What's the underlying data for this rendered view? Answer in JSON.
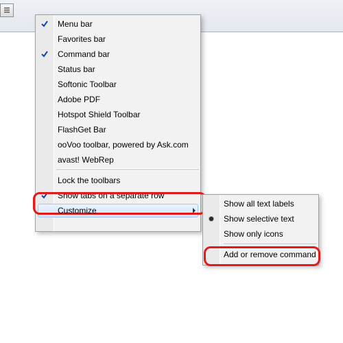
{
  "mainMenu": {
    "items": [
      {
        "label": "Menu bar",
        "checked": true,
        "submenu": false
      },
      {
        "label": "Favorites bar",
        "checked": false,
        "submenu": false
      },
      {
        "label": "Command bar",
        "checked": true,
        "submenu": false
      },
      {
        "label": "Status bar",
        "checked": false,
        "submenu": false
      },
      {
        "label": "Softonic Toolbar",
        "checked": false,
        "submenu": false
      },
      {
        "label": "Adobe PDF",
        "checked": false,
        "submenu": false
      },
      {
        "label": "Hotspot Shield Toolbar",
        "checked": false,
        "submenu": false
      },
      {
        "label": "FlashGet Bar",
        "checked": false,
        "submenu": false
      },
      {
        "label": "ooVoo toolbar, powered by Ask.com",
        "checked": false,
        "submenu": false
      },
      {
        "label": "avast! WebRep",
        "checked": false,
        "submenu": false
      },
      {
        "sep": true
      },
      {
        "label": "Lock the toolbars",
        "checked": false,
        "submenu": false
      },
      {
        "label": "Show tabs on a separate row",
        "checked": true,
        "submenu": false
      },
      {
        "label": "Customize",
        "checked": false,
        "submenu": true,
        "hover": true
      }
    ]
  },
  "subMenu": {
    "items": [
      {
        "label": "Show all text labels",
        "radio": false
      },
      {
        "label": "Show selective text",
        "radio": true
      },
      {
        "label": "Show only icons",
        "radio": false
      },
      {
        "sep": true
      },
      {
        "label": "Add or remove commands"
      }
    ]
  }
}
